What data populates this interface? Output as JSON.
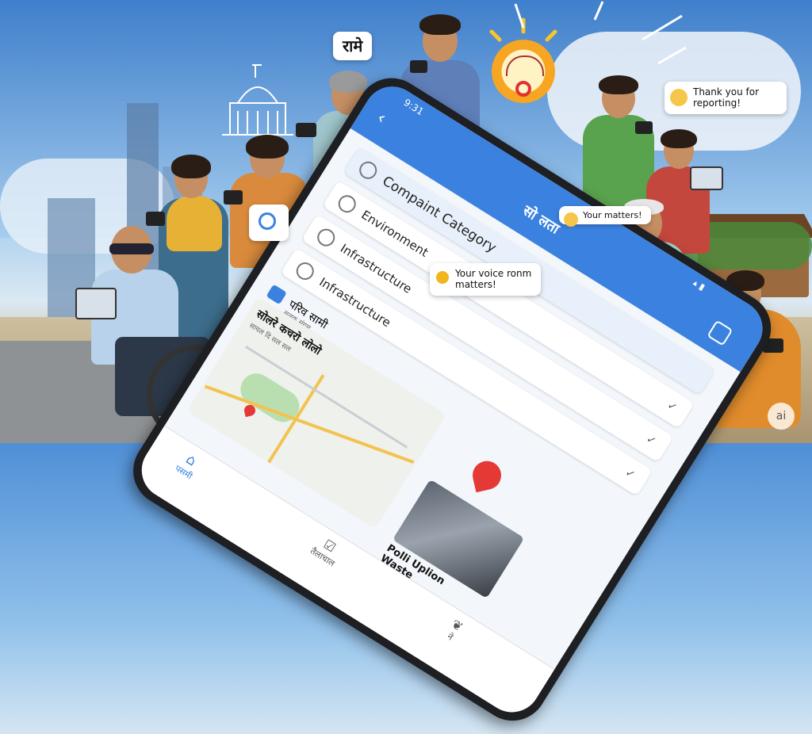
{
  "colors": {
    "accent": "#3b82e0",
    "pin": "#e53935",
    "sunflower": "#f1b51d"
  },
  "phone": {
    "status_time": "9:31",
    "header_title": "सो लता",
    "back_icon": "chevron-left-icon",
    "category_title": "Compaint Category",
    "categories": [
      {
        "label": "Environment"
      },
      {
        "label": "Infrastructure"
      },
      {
        "label": "Infrastructure"
      }
    ],
    "report_title": "परिव सामी",
    "report_sub": "सलक संगम",
    "location_title": "सोलरे कचरो लोलो",
    "location_sub": "सायल दि सल सल",
    "photo_caption": "Polli Uplion Waste",
    "nav": [
      {
        "label": "पसमी"
      },
      {
        "label": "तैलाचाल"
      },
      {
        "label": "ने"
      }
    ]
  },
  "bubbles": {
    "hindi": "रामे",
    "thanks": "Thank you for reporting!",
    "your_matters": "Your matters!",
    "your_voice": "Your voice ronm matters!"
  },
  "watermark": "ai"
}
